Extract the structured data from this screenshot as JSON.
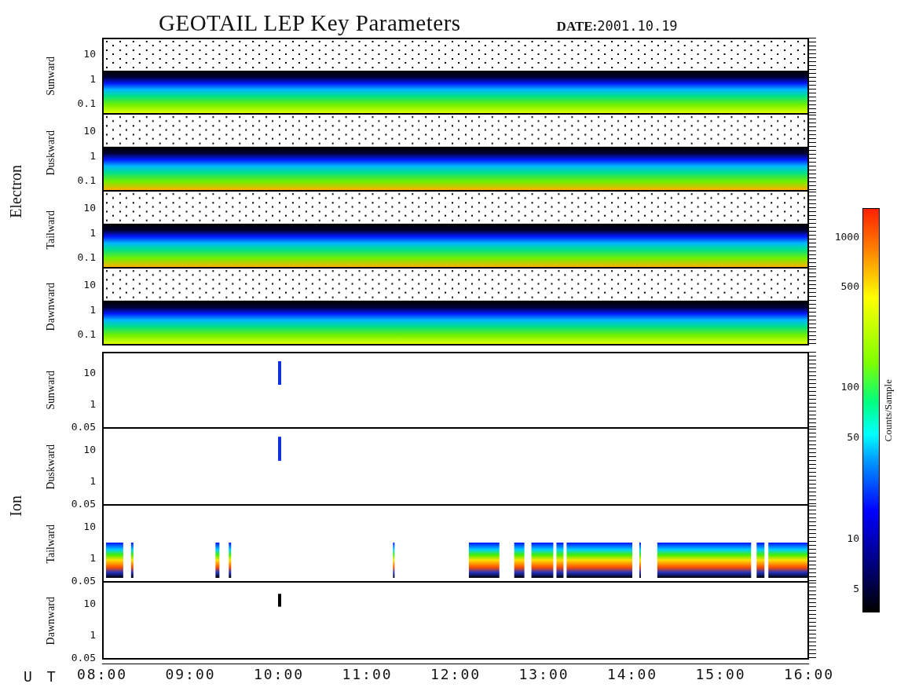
{
  "title": "GEOTAIL LEP Key Parameters",
  "date_label": "DATE:",
  "date_value": "2001.10.19",
  "groups": [
    {
      "label": "Electron",
      "kind": "electron",
      "panels": [
        {
          "direction": "Sunward",
          "yticks": [
            "10",
            "1",
            "0.1"
          ]
        },
        {
          "direction": "Duskward",
          "yticks": [
            "10",
            "1",
            "0.1"
          ]
        },
        {
          "direction": "Tailward",
          "yticks": [
            "10",
            "1",
            "0.1"
          ]
        },
        {
          "direction": "Dawnward",
          "yticks": [
            "10",
            "1",
            "0.1"
          ]
        }
      ]
    },
    {
      "label": "Ion",
      "kind": "ion",
      "panels": [
        {
          "direction": "Sunward",
          "yticks": [
            "10",
            "1",
            "0.05"
          ]
        },
        {
          "direction": "Duskward",
          "yticks": [
            "10",
            "1",
            "0.05"
          ]
        },
        {
          "direction": "Tailward",
          "yticks": [
            "10",
            "1",
            "0.05"
          ]
        },
        {
          "direction": "Dawnward",
          "yticks": [
            "10",
            "1",
            "0.05"
          ]
        }
      ]
    }
  ],
  "x_axis": {
    "label": "U T",
    "ticks": [
      "08:00",
      "09:00",
      "10:00",
      "11:00",
      "12:00",
      "13:00",
      "14:00",
      "15:00",
      "16:00"
    ]
  },
  "colorbar": {
    "label": "Counts/Sample",
    "ticks": [
      "1000",
      "500",
      "100",
      "50",
      "10",
      "5"
    ]
  }
}
